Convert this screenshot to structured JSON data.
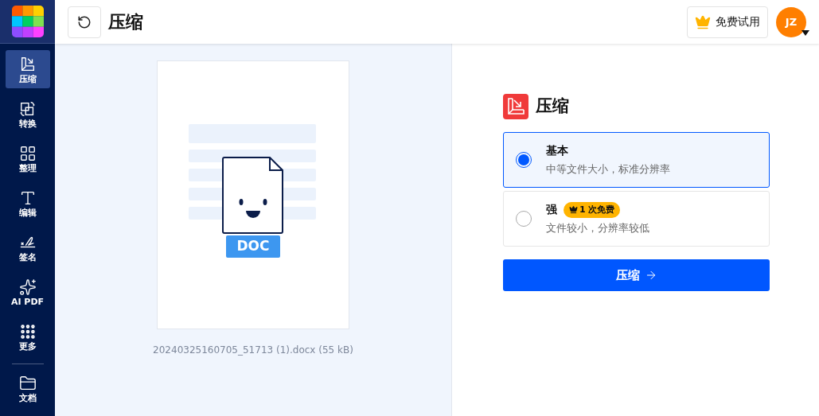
{
  "sidebar": {
    "items": [
      {
        "label": "压缩",
        "selected": true
      },
      {
        "label": "转换",
        "selected": false
      },
      {
        "label": "整理",
        "selected": false
      },
      {
        "label": "编辑",
        "selected": false
      },
      {
        "label": "签名",
        "selected": false
      },
      {
        "label": "AI PDF",
        "selected": false
      },
      {
        "label": "更多",
        "selected": false
      }
    ],
    "footer_item": {
      "label": "文档",
      "selected": false
    }
  },
  "header": {
    "title": "压缩",
    "trial_button": "免费试用",
    "avatar": "JZ"
  },
  "preview": {
    "badge": "DOC",
    "filename": "20240325160705_51713 (1).docx (55 kB)"
  },
  "panel": {
    "title": "压缩",
    "options": [
      {
        "title": "基本",
        "description": "中等文件大小，标准分辨率",
        "selected": true
      },
      {
        "title": "强",
        "badge": "1 次免费",
        "description": "文件较小，分辨率较低",
        "selected": false
      }
    ],
    "button": "压缩"
  }
}
